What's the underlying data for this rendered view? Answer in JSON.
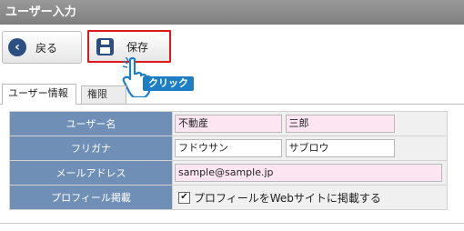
{
  "window": {
    "title": "ユーザー入力"
  },
  "toolbar": {
    "back_label": "戻る",
    "save_label": "保存"
  },
  "overlay": {
    "click_badge": "クリック"
  },
  "tabs": [
    {
      "label": "ユーザー情報",
      "active": true
    },
    {
      "label": "権限",
      "active": false
    }
  ],
  "form": {
    "user_name": {
      "label": "ユーザー名",
      "last": "不動産",
      "first": "三郎"
    },
    "furigana": {
      "label": "フリガナ",
      "last": "フドウサン",
      "first": "サブロウ"
    },
    "email": {
      "label": "メールアドレス",
      "value": "sample@sample.jp"
    },
    "profile": {
      "label": "プロフィール掲載",
      "checked": true,
      "text": "プロフィールをWebサイトに掲載する"
    }
  },
  "colors": {
    "title_bar": "#8a8a8a",
    "label_cell": "#6f8fb6",
    "required_field": "#fde6f2",
    "highlight": "#e01818",
    "icon": "#2c4f83",
    "badge": "#1d7ec4"
  }
}
